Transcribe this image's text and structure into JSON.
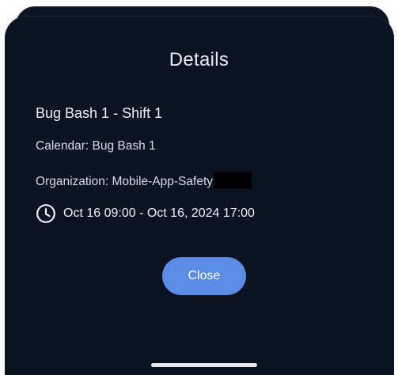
{
  "dialog": {
    "title": "Details",
    "event_title": "Bug Bash 1 - Shift 1",
    "calendar": "Calendar: Bug Bash 1",
    "organization": "Organization: Mobile-App-Safety",
    "time_range": "Oct 16 09:00 - Oct 16, 2024 17:00",
    "time_icon": "clock-icon",
    "close_label": "Close"
  },
  "colors": {
    "background": "#0b1220",
    "accent_button": "#5b8ce6",
    "text": "#eef1f6"
  }
}
